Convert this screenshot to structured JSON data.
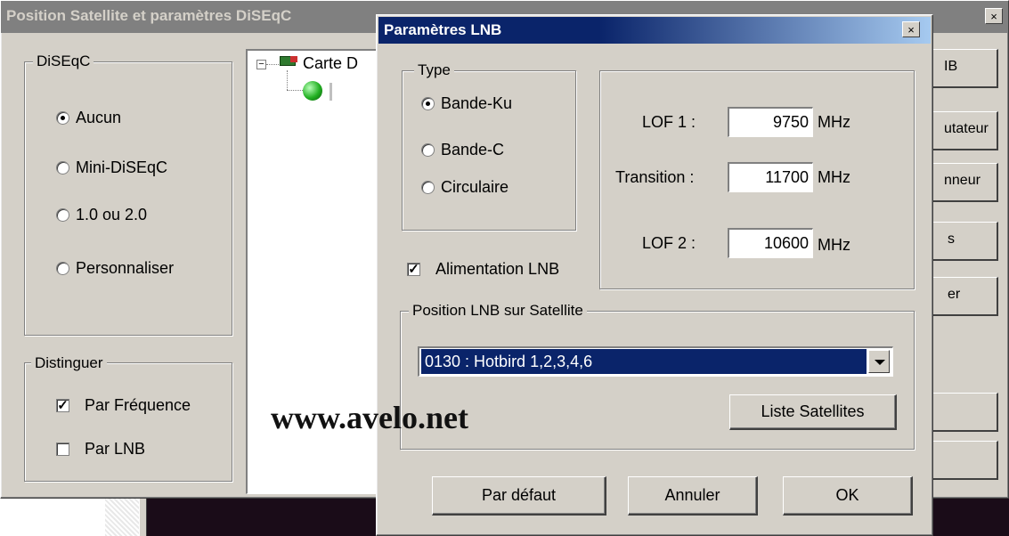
{
  "back_window": {
    "title": "Position Satellite et paramètres DiSEqC",
    "close_glyph": "×",
    "diseqc_group": {
      "label": "DiSEqC",
      "options": [
        "Aucun",
        "Mini-DiSEqC",
        "1.0 ou 2.0",
        "Personnaliser"
      ],
      "selected": "Aucun"
    },
    "distinguer_group": {
      "label": "Distinguer",
      "par_frequence": "Par Fréquence",
      "par_frequence_checked": true,
      "par_lnb": "Par LNB",
      "par_lnb_checked": false
    },
    "tree_item": "Carte D",
    "right_buttons": [
      "IB",
      "utateur",
      "nneur",
      "s",
      "er"
    ]
  },
  "lnb_dialog": {
    "title": "Paramètres LNB",
    "close_glyph": "×",
    "type_group": {
      "label": "Type",
      "options": [
        "Bande-Ku",
        "Bande-C",
        "Circulaire"
      ],
      "selected": "Bande-Ku"
    },
    "lof1_label": "LOF 1 :",
    "lof1_value": "9750",
    "transition_label": "Transition :",
    "transition_value": "11700",
    "lof2_label": "LOF 2 :",
    "lof2_value": "10600",
    "unit": "MHz",
    "alimentation_label": "Alimentation LNB",
    "alimentation_checked": true,
    "position_group": {
      "label": "Position LNB sur Satellite",
      "selected_satellite": "0130 : Hotbird 1,2,3,4,6",
      "liste_button": "Liste Satellites"
    },
    "buttons": {
      "default": "Par défaut",
      "cancel": "Annuler",
      "ok": "OK"
    }
  },
  "watermark": "www.avelo.net",
  "colors": {
    "dialog_face": "#d4d0c8",
    "active_title": "#0a246a",
    "inactive_title": "#808080",
    "selection": "#0a246a",
    "desktop_dark": "#1a0c18"
  }
}
